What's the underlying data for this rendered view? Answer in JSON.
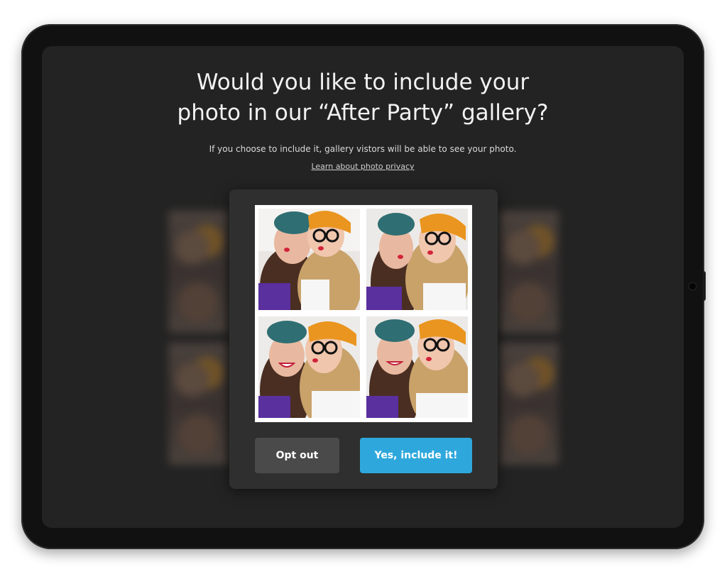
{
  "prompt": {
    "title_line1": "Would you like to include your",
    "title_line2": "photo in our “After Party” gallery?",
    "subtitle": "If you choose to include it, gallery vistors will be able to see your photo.",
    "privacy_link": "Learn about photo privacy"
  },
  "card": {
    "photos": [
      {
        "name": "photo-top-left"
      },
      {
        "name": "photo-top-right"
      },
      {
        "name": "photo-bottom-left"
      },
      {
        "name": "photo-bottom-right"
      }
    ],
    "opt_out_label": "Opt out",
    "include_label": "Yes, include it!"
  },
  "colors": {
    "screen_bg": "#232323",
    "card_bg": "#2f2f2f",
    "opt_out_bg": "#4a4a4a",
    "include_bg": "#2ea8dc"
  }
}
